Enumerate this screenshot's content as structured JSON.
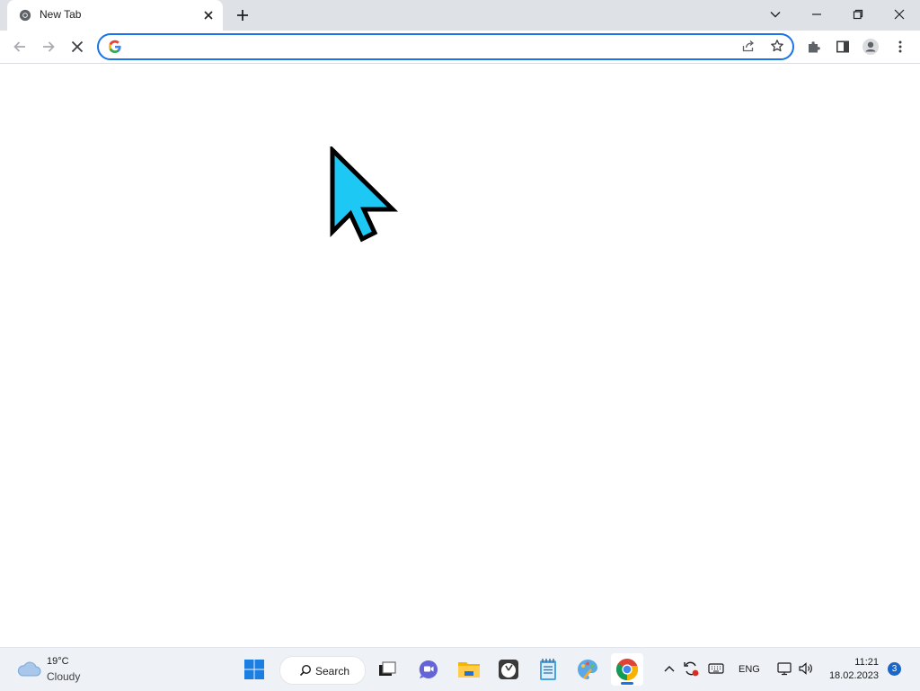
{
  "browser": {
    "tab": {
      "title": "New Tab"
    },
    "omnibox": {
      "value": "",
      "placeholder": ""
    }
  },
  "taskbar": {
    "weather": {
      "temperature": "19°C",
      "condition": "Cloudy"
    },
    "search_label": "Search",
    "apps": [
      "start-icon",
      "task-view-icon",
      "chat-icon",
      "file-explorer-icon",
      "clock-app-icon",
      "notepad-icon",
      "paint-icon",
      "chrome-icon"
    ],
    "tray": {
      "language": "ENG",
      "time": "11:21",
      "date": "18.02.2023",
      "notification_count": "3"
    }
  },
  "colors": {
    "accent": "#1a73e8",
    "cursor_fill": "#1ec8f5",
    "tabstrip_bg": "#dee1e6",
    "taskbar_bg": "#eef1f6"
  }
}
